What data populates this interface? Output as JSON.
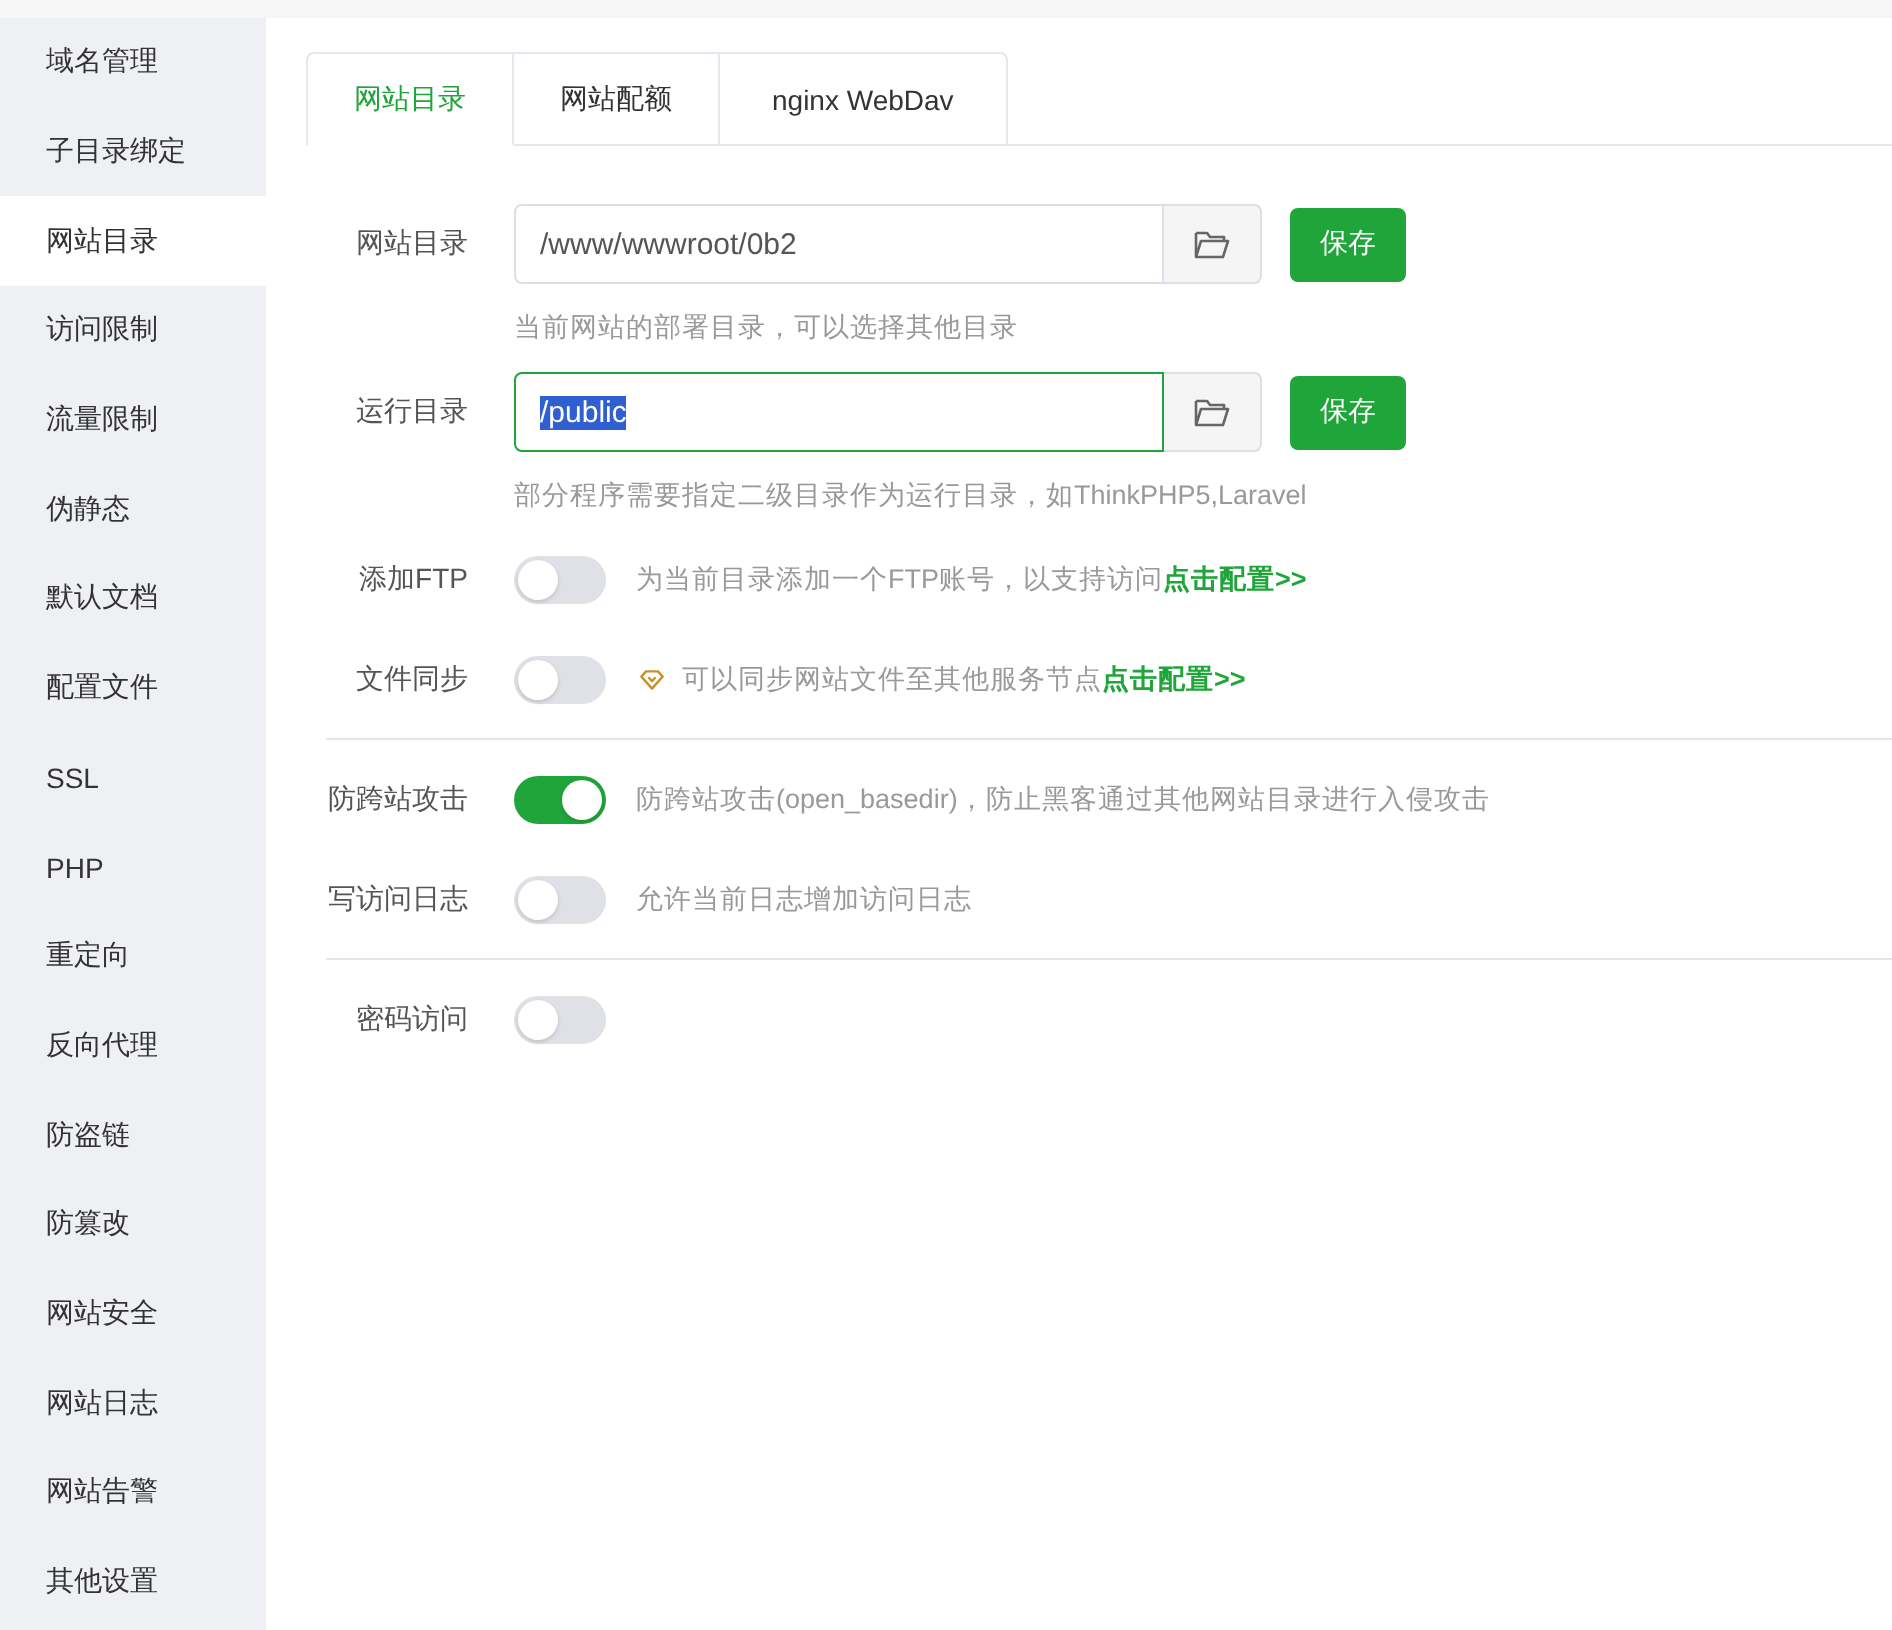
{
  "sidebar": {
    "items": [
      {
        "label": "域名管理",
        "selected": false
      },
      {
        "label": "子目录绑定",
        "selected": false
      },
      {
        "label": "网站目录",
        "selected": true
      },
      {
        "label": "访问限制",
        "selected": false
      },
      {
        "label": "流量限制",
        "selected": false
      },
      {
        "label": "伪静态",
        "selected": false
      },
      {
        "label": "默认文档",
        "selected": false
      },
      {
        "label": "配置文件",
        "selected": false
      },
      {
        "label": "SSL",
        "selected": false
      },
      {
        "label": "PHP",
        "selected": false
      },
      {
        "label": "重定向",
        "selected": false
      },
      {
        "label": "反向代理",
        "selected": false
      },
      {
        "label": "防盗链",
        "selected": false
      },
      {
        "label": "防篡改",
        "selected": false
      },
      {
        "label": "网站安全",
        "selected": false
      },
      {
        "label": "网站日志",
        "selected": false
      },
      {
        "label": "网站告警",
        "selected": false
      },
      {
        "label": "其他设置",
        "selected": false
      }
    ]
  },
  "tabs": [
    {
      "label": "网站目录",
      "selected": true
    },
    {
      "label": "网站配额",
      "selected": false
    },
    {
      "label": "nginx WebDav",
      "selected": false
    }
  ],
  "form": {
    "directory_rows": [
      {
        "label": "网站目录",
        "value": "/www/wwwroot/0b2",
        "focused": false,
        "value_highlighted": false,
        "button": "保存",
        "hint": "当前网站的部署目录，可以选择其他目录"
      },
      {
        "label": "运行目录",
        "value": "/public",
        "focused": true,
        "value_highlighted": true,
        "button": "保存",
        "hint": "部分程序需要指定二级目录作为运行目录，如ThinkPHP5,Laravel"
      }
    ],
    "toggle_groups": [
      {
        "toggles": [
          {
            "label": "添加FTP",
            "on": false,
            "gem": false,
            "description": "为当前目录添加一个FTP账号，以支持访问",
            "link": "点击配置>>"
          },
          {
            "label": "文件同步",
            "on": false,
            "gem": true,
            "description": "可以同步网站文件至其他服务节点",
            "link": "点击配置>>"
          }
        ]
      },
      {
        "toggles": [
          {
            "label": "防跨站攻击",
            "on": true,
            "gem": false,
            "description": "防跨站攻击(open_basedir)，防止黑客通过其他网站目录进行入侵攻击"
          },
          {
            "label": "写访问日志",
            "on": false,
            "gem": false,
            "description": "允许当前日志增加访问日志"
          }
        ]
      },
      {
        "toggles": [
          {
            "label": "密码访问",
            "on": false,
            "gem": false
          }
        ]
      }
    ]
  }
}
